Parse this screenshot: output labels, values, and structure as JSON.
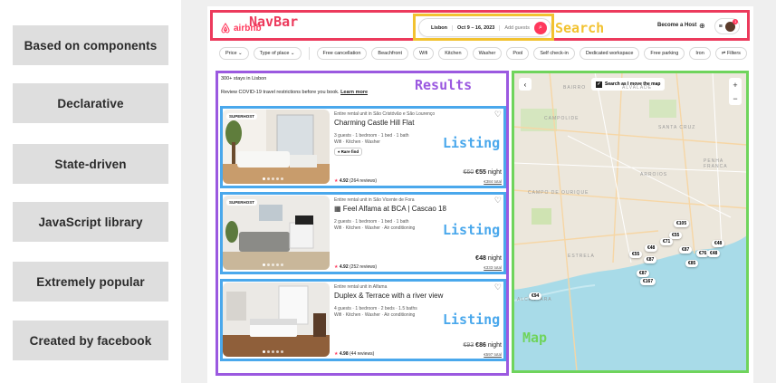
{
  "nav": {
    "items": [
      {
        "label": "Based on components",
        "active": true
      },
      {
        "label": "Declarative",
        "active": false
      },
      {
        "label": "State-driven",
        "active": false
      },
      {
        "label": "JavaScript library",
        "active": false
      },
      {
        "label": "Extremely popular",
        "active": false
      },
      {
        "label": "Created by facebook",
        "active": false
      }
    ]
  },
  "annotations": {
    "navbar": "NavBar",
    "search": "Search",
    "results": "Results",
    "listing": "Listing",
    "map": "Map",
    "colors": {
      "navbar": "#ec3a5c",
      "search": "#f2c230",
      "results": "#9b59e0",
      "listing": "#4aa8ec",
      "map": "#6fd45c"
    }
  },
  "airbnb": {
    "logo": "airbnb",
    "search": {
      "location": "Lisbon",
      "dates": "Oct 9 – 16, 2023",
      "guests": "Add guests"
    },
    "become_host": "Become a Host",
    "notification_count": "1",
    "filters": [
      "Price",
      "Type of place",
      "Free cancellation",
      "Beachfront",
      "Wifi",
      "Kitchen",
      "Washer",
      "Pool",
      "Self check-in",
      "Dedicated workspace",
      "Free parking",
      "Iron",
      "Filters"
    ],
    "stays_count": "300+ stays in Lisbon",
    "covid_text": "Review COVID-19 travel restrictions before you book.",
    "covid_link": "Learn more",
    "listings": [
      {
        "badge": "SUPERHOST",
        "subtitle": "Entire rental unit in São Cristóvão e São Lourenço",
        "title": "Charming Castle Hill Flat",
        "line1": "3 guests · 1 bedroom · 1 bed · 1 bath",
        "line2": "Wifi · Kitchen · Washer",
        "tag": "Rare find",
        "rating": "4.92",
        "reviews": "(264 reviews)",
        "old_price": "€60",
        "price": "€55",
        "per": "night",
        "total": "€384 total"
      },
      {
        "badge": "SUPERHOST",
        "subtitle": "Entire rental unit in São Vicente de Fora",
        "title": "Feel Alfama at BCA | Cascao 18",
        "line1": "2 guests · 1 bedroom · 1 bed · 1 bath",
        "line2": "Wifi · Kitchen · Washer · Air conditioning",
        "tag": "",
        "rating": "4.92",
        "reviews": "(252 reviews)",
        "old_price": "",
        "price": "€48",
        "per": "night",
        "total": "€333 total"
      },
      {
        "badge": "",
        "subtitle": "Entire rental unit in Alfama",
        "title": "Duplex & Terrace with a river view",
        "line1": "4 guests · 1 bedroom · 2 beds · 1.5 baths",
        "line2": "Wifi · Kitchen · Washer · Air conditioning",
        "tag": "",
        "rating": "4.98",
        "reviews": "(44 reviews)",
        "old_price": "€93",
        "price": "€86",
        "per": "night",
        "total": "€597 total"
      }
    ],
    "map": {
      "toggle_label": "Search as I move the map",
      "zoom_in": "+",
      "zoom_out": "−",
      "back": "‹",
      "places": [
        "CAMPOLIDE",
        "SANTA CRUZ",
        "PENHA FRANCA",
        "CAMPO DE OURIQUE",
        "ARROIOS",
        "ESTRELA",
        "ALCANTARA",
        "ALVALADE",
        "BAIRRO"
      ],
      "markers": [
        "€105",
        "€55",
        "€71",
        "€48",
        "€87",
        "€48",
        "€76",
        "€48",
        "€55",
        "€87",
        "€85",
        "€87",
        "€167",
        "€94"
      ]
    }
  }
}
